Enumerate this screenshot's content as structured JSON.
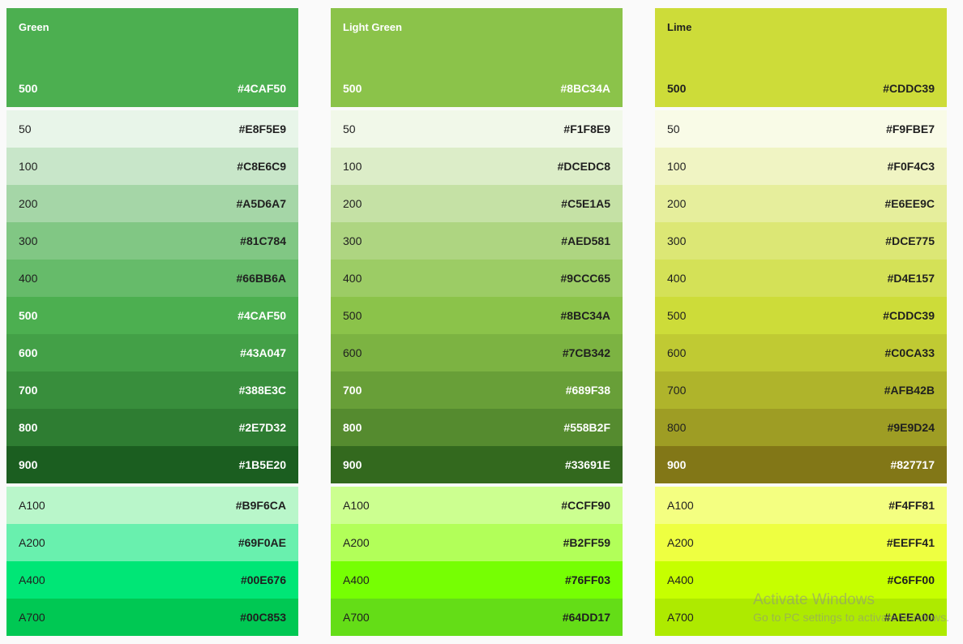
{
  "palettes": [
    {
      "name": "Green",
      "header": {
        "shade": "500",
        "hex": "#4CAF50",
        "bg": "#4CAF50",
        "text": "dark"
      },
      "shades": [
        {
          "shade": "50",
          "hex": "#E8F5E9",
          "bg": "#E8F5E9",
          "text": "light"
        },
        {
          "shade": "100",
          "hex": "#C8E6C9",
          "bg": "#C8E6C9",
          "text": "light"
        },
        {
          "shade": "200",
          "hex": "#A5D6A7",
          "bg": "#A5D6A7",
          "text": "light"
        },
        {
          "shade": "300",
          "hex": "#81C784",
          "bg": "#81C784",
          "text": "light"
        },
        {
          "shade": "400",
          "hex": "#66BB6A",
          "bg": "#66BB6A",
          "text": "light"
        },
        {
          "shade": "500",
          "hex": "#4CAF50",
          "bg": "#4CAF50",
          "text": "dark"
        },
        {
          "shade": "600",
          "hex": "#43A047",
          "bg": "#43A047",
          "text": "dark"
        },
        {
          "shade": "700",
          "hex": "#388E3C",
          "bg": "#388E3C",
          "text": "dark"
        },
        {
          "shade": "800",
          "hex": "#2E7D32",
          "bg": "#2E7D32",
          "text": "dark"
        },
        {
          "shade": "900",
          "hex": "#1B5E20",
          "bg": "#1B5E20",
          "text": "dark"
        }
      ],
      "accents": [
        {
          "shade": "A100",
          "hex": "#B9F6CA",
          "bg": "#B9F6CA",
          "text": "light"
        },
        {
          "shade": "A200",
          "hex": "#69F0AE",
          "bg": "#69F0AE",
          "text": "light"
        },
        {
          "shade": "A400",
          "hex": "#00E676",
          "bg": "#00E676",
          "text": "light"
        },
        {
          "shade": "A700",
          "hex": "#00C853",
          "bg": "#00C853",
          "text": "light"
        }
      ]
    },
    {
      "name": "Light Green",
      "header": {
        "shade": "500",
        "hex": "#8BC34A",
        "bg": "#8BC34A",
        "text": "dark"
      },
      "shades": [
        {
          "shade": "50",
          "hex": "#F1F8E9",
          "bg": "#F1F8E9",
          "text": "light"
        },
        {
          "shade": "100",
          "hex": "#DCEDC8",
          "bg": "#DCEDC8",
          "text": "light"
        },
        {
          "shade": "200",
          "hex": "#C5E1A5",
          "bg": "#C5E1A5",
          "text": "light"
        },
        {
          "shade": "300",
          "hex": "#AED581",
          "bg": "#AED581",
          "text": "light"
        },
        {
          "shade": "400",
          "hex": "#9CCC65",
          "bg": "#9CCC65",
          "text": "light"
        },
        {
          "shade": "500",
          "hex": "#8BC34A",
          "bg": "#8BC34A",
          "text": "light"
        },
        {
          "shade": "600",
          "hex": "#7CB342",
          "bg": "#7CB342",
          "text": "light"
        },
        {
          "shade": "700",
          "hex": "#689F38",
          "bg": "#689F38",
          "text": "dark"
        },
        {
          "shade": "800",
          "hex": "#558B2F",
          "bg": "#558B2F",
          "text": "dark"
        },
        {
          "shade": "900",
          "hex": "#33691E",
          "bg": "#33691E",
          "text": "dark"
        }
      ],
      "accents": [
        {
          "shade": "A100",
          "hex": "#CCFF90",
          "bg": "#CCFF90",
          "text": "light"
        },
        {
          "shade": "A200",
          "hex": "#B2FF59",
          "bg": "#B2FF59",
          "text": "light"
        },
        {
          "shade": "A400",
          "hex": "#76FF03",
          "bg": "#76FF03",
          "text": "light"
        },
        {
          "shade": "A700",
          "hex": "#64DD17",
          "bg": "#64DD17",
          "text": "light"
        }
      ]
    },
    {
      "name": "Lime",
      "header": {
        "shade": "500",
        "hex": "#CDDC39",
        "bg": "#CDDC39",
        "text": "light"
      },
      "shades": [
        {
          "shade": "50",
          "hex": "#F9FBE7",
          "bg": "#F9FBE7",
          "text": "light"
        },
        {
          "shade": "100",
          "hex": "#F0F4C3",
          "bg": "#F0F4C3",
          "text": "light"
        },
        {
          "shade": "200",
          "hex": "#E6EE9C",
          "bg": "#E6EE9C",
          "text": "light"
        },
        {
          "shade": "300",
          "hex": "#DCE775",
          "bg": "#DCE775",
          "text": "light"
        },
        {
          "shade": "400",
          "hex": "#D4E157",
          "bg": "#D4E157",
          "text": "light"
        },
        {
          "shade": "500",
          "hex": "#CDDC39",
          "bg": "#CDDC39",
          "text": "light"
        },
        {
          "shade": "600",
          "hex": "#C0CA33",
          "bg": "#C0CA33",
          "text": "light"
        },
        {
          "shade": "700",
          "hex": "#AFB42B",
          "bg": "#AFB42B",
          "text": "light"
        },
        {
          "shade": "800",
          "hex": "#9E9D24",
          "bg": "#9E9D24",
          "text": "light"
        },
        {
          "shade": "900",
          "hex": "#827717",
          "bg": "#827717",
          "text": "dark"
        }
      ],
      "accents": [
        {
          "shade": "A100",
          "hex": "#F4FF81",
          "bg": "#F4FF81",
          "text": "light"
        },
        {
          "shade": "A200",
          "hex": "#EEFF41",
          "bg": "#EEFF41",
          "text": "light"
        },
        {
          "shade": "A400",
          "hex": "#C6FF00",
          "bg": "#C6FF00",
          "text": "light"
        },
        {
          "shade": "A700",
          "hex": "#AEEA00",
          "bg": "#AEEA00",
          "text": "light"
        }
      ]
    }
  ],
  "watermark": {
    "title": "Activate Windows",
    "subtitle": "Go to PC settings to activate Windows."
  }
}
